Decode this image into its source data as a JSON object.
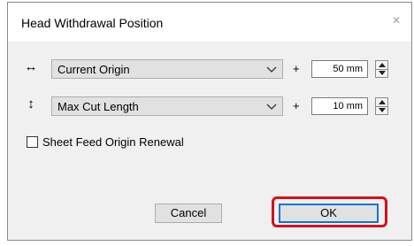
{
  "dialog": {
    "title": "Head Withdrawal Position",
    "close_glyph": "×"
  },
  "rows": [
    {
      "icon": "horizontal-arrows-icon",
      "icon_glyph": "↔",
      "select_value": "Current Origin",
      "plus": "+",
      "number": "50",
      "unit": "mm"
    },
    {
      "icon": "vertical-arrows-icon",
      "icon_glyph": "↕",
      "select_value": "Max Cut Length",
      "plus": "+",
      "number": "10",
      "unit": "mm"
    }
  ],
  "checkbox": {
    "label": "Sheet Feed Origin Renewal",
    "checked": false
  },
  "buttons": {
    "cancel": "Cancel",
    "ok": "OK"
  },
  "colors": {
    "highlight": "#d4101c",
    "focus": "#0078d7"
  }
}
